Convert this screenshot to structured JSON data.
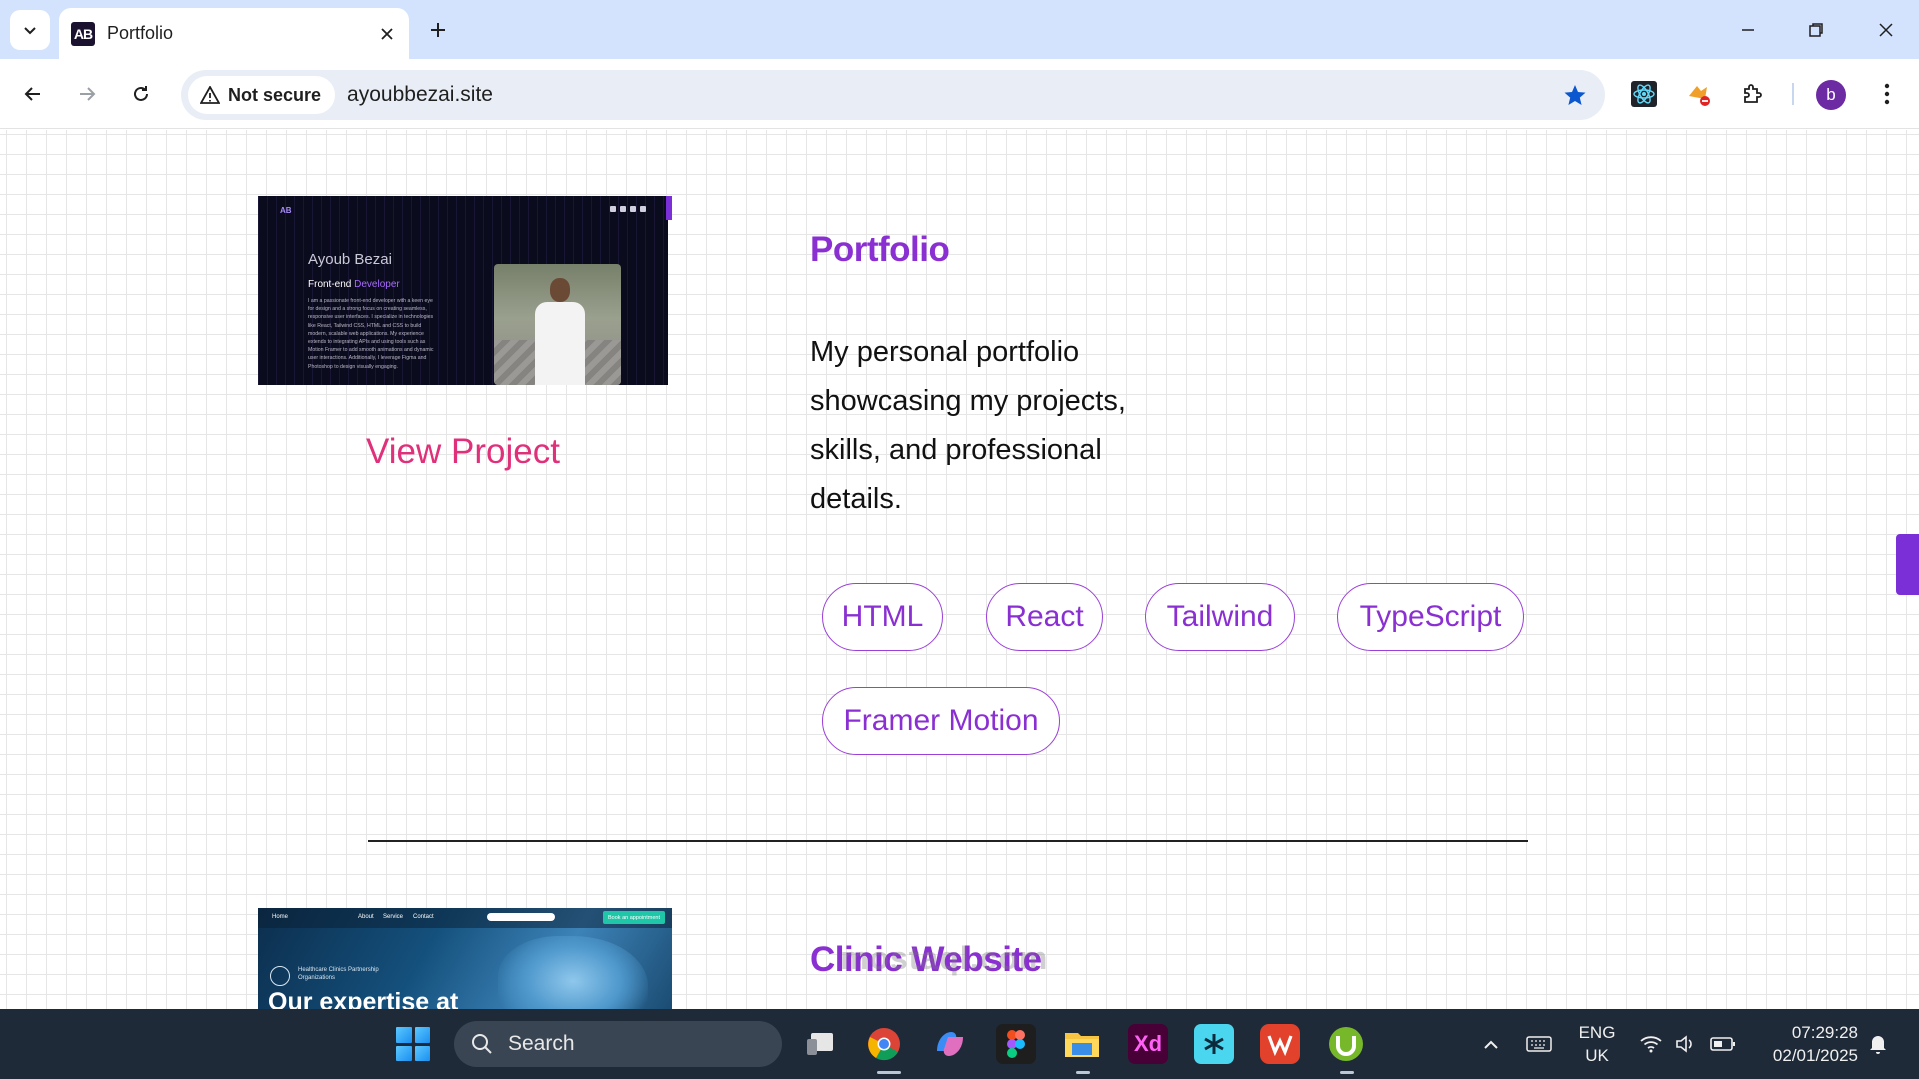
{
  "browser": {
    "tab_title": "Portfolio",
    "tab_favicon_text": "AB",
    "security_label": "Not secure",
    "url": "ayoubbezai.site",
    "profile_initial": "b"
  },
  "projects": [
    {
      "title": "Portfolio",
      "description": "My personal portfolio showcasing my projects, skills, and professional details.",
      "link_label": "View Project",
      "tags": [
        "HTML",
        "React",
        "Tailwind",
        "TypeScript",
        "Framer Motion"
      ],
      "thumbnail": {
        "logo": "AB",
        "name": "Ayoub Bezai",
        "role_prefix": "Front-end",
        "role_highlight": "Developer",
        "bio": "I am a passionate front-end developer with a keen eye for design and a strong focus on creating seamless, responsive user interfaces. I specialize in technologies like React, Tailwind CSS, HTML and CSS to build modern, scalable web applications. My experience extends to integrating APIs and using tools such as Motion Framer to add smooth animations and dynamic user interactions. Additionally, I leverage Figma and Photoshop to design visually engaging."
      }
    },
    {
      "title": "Clinic Website",
      "thumbnail": {
        "nav": [
          "Home",
          "About",
          "Service",
          "Contact"
        ],
        "cta": "Book an appointment",
        "org": "Healthcare Clinics Partnership Organizations",
        "headline": "Our expertise at"
      }
    }
  ],
  "watermark": "mostaql.com",
  "taskbar": {
    "search_label": "Search",
    "language": "ENG",
    "region": "UK",
    "time": "07:29:28",
    "date": "02/01/2025",
    "xd_label": "Xd"
  },
  "colors": {
    "accent_purple": "#8a2fd1",
    "link_pink": "#e0307a",
    "bookmark_star": "#0b57d0"
  }
}
